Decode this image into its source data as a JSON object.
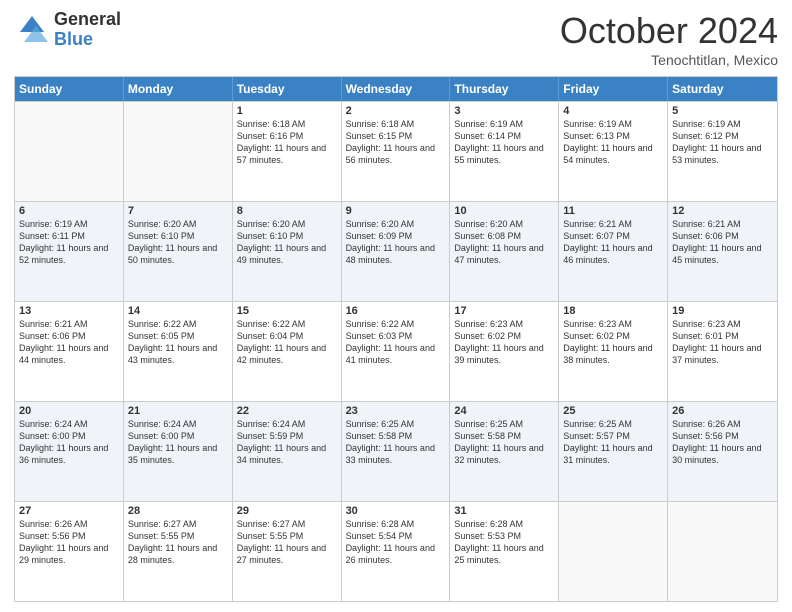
{
  "header": {
    "logo_general": "General",
    "logo_blue": "Blue",
    "month_title": "October 2024",
    "location": "Tenochtitlan, Mexico"
  },
  "weekdays": [
    "Sunday",
    "Monday",
    "Tuesday",
    "Wednesday",
    "Thursday",
    "Friday",
    "Saturday"
  ],
  "rows": [
    [
      {
        "day": "",
        "sunrise": "",
        "sunset": "",
        "daylight": ""
      },
      {
        "day": "",
        "sunrise": "",
        "sunset": "",
        "daylight": ""
      },
      {
        "day": "1",
        "sunrise": "Sunrise: 6:18 AM",
        "sunset": "Sunset: 6:16 PM",
        "daylight": "Daylight: 11 hours and 57 minutes."
      },
      {
        "day": "2",
        "sunrise": "Sunrise: 6:18 AM",
        "sunset": "Sunset: 6:15 PM",
        "daylight": "Daylight: 11 hours and 56 minutes."
      },
      {
        "day": "3",
        "sunrise": "Sunrise: 6:19 AM",
        "sunset": "Sunset: 6:14 PM",
        "daylight": "Daylight: 11 hours and 55 minutes."
      },
      {
        "day": "4",
        "sunrise": "Sunrise: 6:19 AM",
        "sunset": "Sunset: 6:13 PM",
        "daylight": "Daylight: 11 hours and 54 minutes."
      },
      {
        "day": "5",
        "sunrise": "Sunrise: 6:19 AM",
        "sunset": "Sunset: 6:12 PM",
        "daylight": "Daylight: 11 hours and 53 minutes."
      }
    ],
    [
      {
        "day": "6",
        "sunrise": "Sunrise: 6:19 AM",
        "sunset": "Sunset: 6:11 PM",
        "daylight": "Daylight: 11 hours and 52 minutes."
      },
      {
        "day": "7",
        "sunrise": "Sunrise: 6:20 AM",
        "sunset": "Sunset: 6:10 PM",
        "daylight": "Daylight: 11 hours and 50 minutes."
      },
      {
        "day": "8",
        "sunrise": "Sunrise: 6:20 AM",
        "sunset": "Sunset: 6:10 PM",
        "daylight": "Daylight: 11 hours and 49 minutes."
      },
      {
        "day": "9",
        "sunrise": "Sunrise: 6:20 AM",
        "sunset": "Sunset: 6:09 PM",
        "daylight": "Daylight: 11 hours and 48 minutes."
      },
      {
        "day": "10",
        "sunrise": "Sunrise: 6:20 AM",
        "sunset": "Sunset: 6:08 PM",
        "daylight": "Daylight: 11 hours and 47 minutes."
      },
      {
        "day": "11",
        "sunrise": "Sunrise: 6:21 AM",
        "sunset": "Sunset: 6:07 PM",
        "daylight": "Daylight: 11 hours and 46 minutes."
      },
      {
        "day": "12",
        "sunrise": "Sunrise: 6:21 AM",
        "sunset": "Sunset: 6:06 PM",
        "daylight": "Daylight: 11 hours and 45 minutes."
      }
    ],
    [
      {
        "day": "13",
        "sunrise": "Sunrise: 6:21 AM",
        "sunset": "Sunset: 6:06 PM",
        "daylight": "Daylight: 11 hours and 44 minutes."
      },
      {
        "day": "14",
        "sunrise": "Sunrise: 6:22 AM",
        "sunset": "Sunset: 6:05 PM",
        "daylight": "Daylight: 11 hours and 43 minutes."
      },
      {
        "day": "15",
        "sunrise": "Sunrise: 6:22 AM",
        "sunset": "Sunset: 6:04 PM",
        "daylight": "Daylight: 11 hours and 42 minutes."
      },
      {
        "day": "16",
        "sunrise": "Sunrise: 6:22 AM",
        "sunset": "Sunset: 6:03 PM",
        "daylight": "Daylight: 11 hours and 41 minutes."
      },
      {
        "day": "17",
        "sunrise": "Sunrise: 6:23 AM",
        "sunset": "Sunset: 6:02 PM",
        "daylight": "Daylight: 11 hours and 39 minutes."
      },
      {
        "day": "18",
        "sunrise": "Sunrise: 6:23 AM",
        "sunset": "Sunset: 6:02 PM",
        "daylight": "Daylight: 11 hours and 38 minutes."
      },
      {
        "day": "19",
        "sunrise": "Sunrise: 6:23 AM",
        "sunset": "Sunset: 6:01 PM",
        "daylight": "Daylight: 11 hours and 37 minutes."
      }
    ],
    [
      {
        "day": "20",
        "sunrise": "Sunrise: 6:24 AM",
        "sunset": "Sunset: 6:00 PM",
        "daylight": "Daylight: 11 hours and 36 minutes."
      },
      {
        "day": "21",
        "sunrise": "Sunrise: 6:24 AM",
        "sunset": "Sunset: 6:00 PM",
        "daylight": "Daylight: 11 hours and 35 minutes."
      },
      {
        "day": "22",
        "sunrise": "Sunrise: 6:24 AM",
        "sunset": "Sunset: 5:59 PM",
        "daylight": "Daylight: 11 hours and 34 minutes."
      },
      {
        "day": "23",
        "sunrise": "Sunrise: 6:25 AM",
        "sunset": "Sunset: 5:58 PM",
        "daylight": "Daylight: 11 hours and 33 minutes."
      },
      {
        "day": "24",
        "sunrise": "Sunrise: 6:25 AM",
        "sunset": "Sunset: 5:58 PM",
        "daylight": "Daylight: 11 hours and 32 minutes."
      },
      {
        "day": "25",
        "sunrise": "Sunrise: 6:25 AM",
        "sunset": "Sunset: 5:57 PM",
        "daylight": "Daylight: 11 hours and 31 minutes."
      },
      {
        "day": "26",
        "sunrise": "Sunrise: 6:26 AM",
        "sunset": "Sunset: 5:56 PM",
        "daylight": "Daylight: 11 hours and 30 minutes."
      }
    ],
    [
      {
        "day": "27",
        "sunrise": "Sunrise: 6:26 AM",
        "sunset": "Sunset: 5:56 PM",
        "daylight": "Daylight: 11 hours and 29 minutes."
      },
      {
        "day": "28",
        "sunrise": "Sunrise: 6:27 AM",
        "sunset": "Sunset: 5:55 PM",
        "daylight": "Daylight: 11 hours and 28 minutes."
      },
      {
        "day": "29",
        "sunrise": "Sunrise: 6:27 AM",
        "sunset": "Sunset: 5:55 PM",
        "daylight": "Daylight: 11 hours and 27 minutes."
      },
      {
        "day": "30",
        "sunrise": "Sunrise: 6:28 AM",
        "sunset": "Sunset: 5:54 PM",
        "daylight": "Daylight: 11 hours and 26 minutes."
      },
      {
        "day": "31",
        "sunrise": "Sunrise: 6:28 AM",
        "sunset": "Sunset: 5:53 PM",
        "daylight": "Daylight: 11 hours and 25 minutes."
      },
      {
        "day": "",
        "sunrise": "",
        "sunset": "",
        "daylight": ""
      },
      {
        "day": "",
        "sunrise": "",
        "sunset": "",
        "daylight": ""
      }
    ]
  ]
}
